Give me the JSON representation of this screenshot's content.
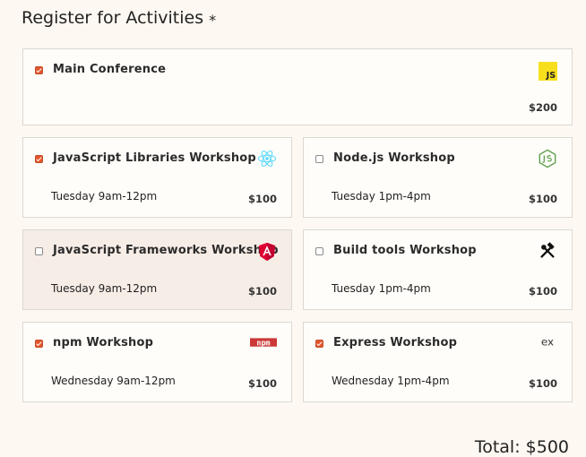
{
  "form": {
    "legend": "Register for Activities",
    "required_mark": "*",
    "total": "Total: $500"
  },
  "activities": [
    {
      "name": "Main Conference",
      "time": "",
      "price": "$200",
      "checked": true,
      "icon": "javascript-logo-icon"
    },
    {
      "name": "JavaScript Libraries Workshop",
      "time": "Tuesday 9am-12pm",
      "price": "$100",
      "checked": true,
      "icon": "react-logo-icon"
    },
    {
      "name": "Node.js Workshop",
      "time": "Tuesday 1pm-4pm",
      "price": "$100",
      "checked": false,
      "icon": "nodejs-logo-icon"
    },
    {
      "name": "JavaScript Frameworks Workshop",
      "time": "Tuesday 9am-12pm",
      "price": "$100",
      "checked": false,
      "icon": "angular-logo-icon"
    },
    {
      "name": "Build tools Workshop",
      "time": "Tuesday 1pm-4pm",
      "price": "$100",
      "checked": false,
      "icon": "hammer-wrench-tools-icon"
    },
    {
      "name": "npm Workshop",
      "time": "Wednesday 9am-12pm",
      "price": "$100",
      "checked": true,
      "icon": "npm-logo-icon"
    },
    {
      "name": "Express Workshop",
      "time": "Wednesday 1pm-4pm",
      "price": "$100",
      "checked": true,
      "icon": "express-logo-icon"
    }
  ],
  "icon_text": {
    "js": "JS",
    "npm": "npm",
    "express": "ex"
  },
  "colors": {
    "checkbox_checked": "#e4572e",
    "js_yellow": "#f7df1e",
    "react_blue": "#61dafb",
    "node_green": "#5fa04e",
    "angular_red": "#dd0031",
    "npm_red": "#cb3837",
    "highlight_bg": "#f7ede7"
  }
}
